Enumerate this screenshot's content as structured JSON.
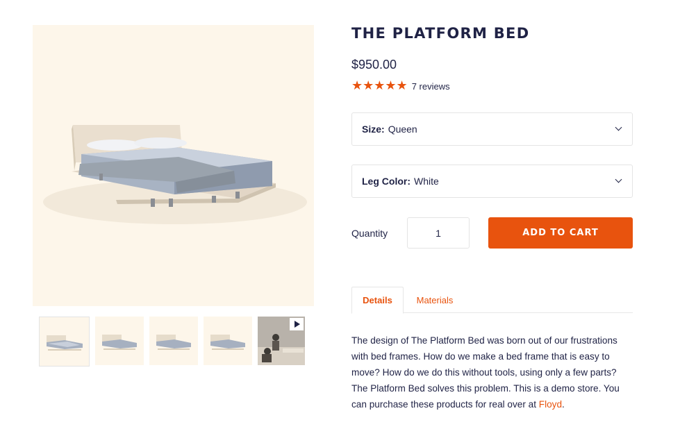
{
  "product": {
    "title": "THE PLATFORM BED",
    "price": "$950.00",
    "rating_stars": "★★★★★",
    "rating_value": 5,
    "reviews": "7 reviews"
  },
  "options": {
    "size": {
      "label": "Size:",
      "value": "Queen"
    },
    "leg_color": {
      "label": "Leg Color:",
      "value": "White"
    }
  },
  "purchase": {
    "quantity_label": "Quantity",
    "quantity_value": "1",
    "add_to_cart": "ADD TO CART"
  },
  "tabs": [
    {
      "label": "Details",
      "active": true
    },
    {
      "label": "Materials",
      "active": false
    }
  ],
  "description": {
    "text": "The design of The Platform Bed was born out of our frustrations with bed frames. How do we make a bed frame that is easy to move? How do we do this without tools, using only a few parts? The Platform Bed solves this problem. This is a demo store. You can purchase these products for real over at ",
    "link_text": "Floyd",
    "end": "."
  },
  "colors": {
    "accent": "#e8530e",
    "text": "#1f2245",
    "image_bg": "#fdf6ea"
  },
  "gallery": {
    "thumbnails": [
      "bed-front",
      "bed-angle",
      "bed-side",
      "bed-back",
      "assembly-video"
    ]
  }
}
